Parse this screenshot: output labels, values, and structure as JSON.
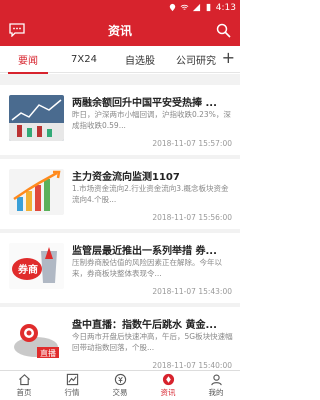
{
  "status": {
    "time": "4:13"
  },
  "header": {
    "title": "资讯"
  },
  "tabs": [
    {
      "label": "要闻",
      "active": true
    },
    {
      "label": "7X24",
      "active": false
    },
    {
      "label": "自选股",
      "active": false
    },
    {
      "label": "公司研究",
      "active": false
    }
  ],
  "news": [
    {
      "title": "两融余额回升中国平安受热捧 ...",
      "desc": "昨日，沪深两市小幅回调，沪指收跌0.23%，深成指收跌0.59...",
      "date": "2018-11-07 15:57:00",
      "thumb": "thumb-chart-icon"
    },
    {
      "title": "主力资金流向监测1107",
      "desc": "1.市场资金流向2.行业资金流向3.概念板块资金流向4.个股...",
      "date": "2018-11-07 15:56:00",
      "thumb": "thumb-growth-icon"
    },
    {
      "title": "监管层最近推出一系列举措 券...",
      "desc": "压制券商股估值的风险因素正在解除。今年以来，券商板块整体表现令...",
      "date": "2018-11-07 15:43:00",
      "thumb": "thumb-broker-icon"
    },
    {
      "title": "盘中直播：指数午后跳水 黄金...",
      "desc": "今日两市开盘后快速冲高，午后，5G板块快速幅回带动指数回落，个股...",
      "date": "2018-11-07 15:40:00",
      "thumb": "thumb-live-icon"
    }
  ],
  "bottom_nav": [
    {
      "label": "首页",
      "icon": "home-icon",
      "active": false
    },
    {
      "label": "行情",
      "icon": "market-icon",
      "active": false
    },
    {
      "label": "交易",
      "icon": "trade-icon",
      "active": false
    },
    {
      "label": "资讯",
      "icon": "news-icon",
      "active": true
    },
    {
      "label": "我的",
      "icon": "profile-icon",
      "active": false
    }
  ],
  "colors": {
    "accent": "#d7232d"
  }
}
